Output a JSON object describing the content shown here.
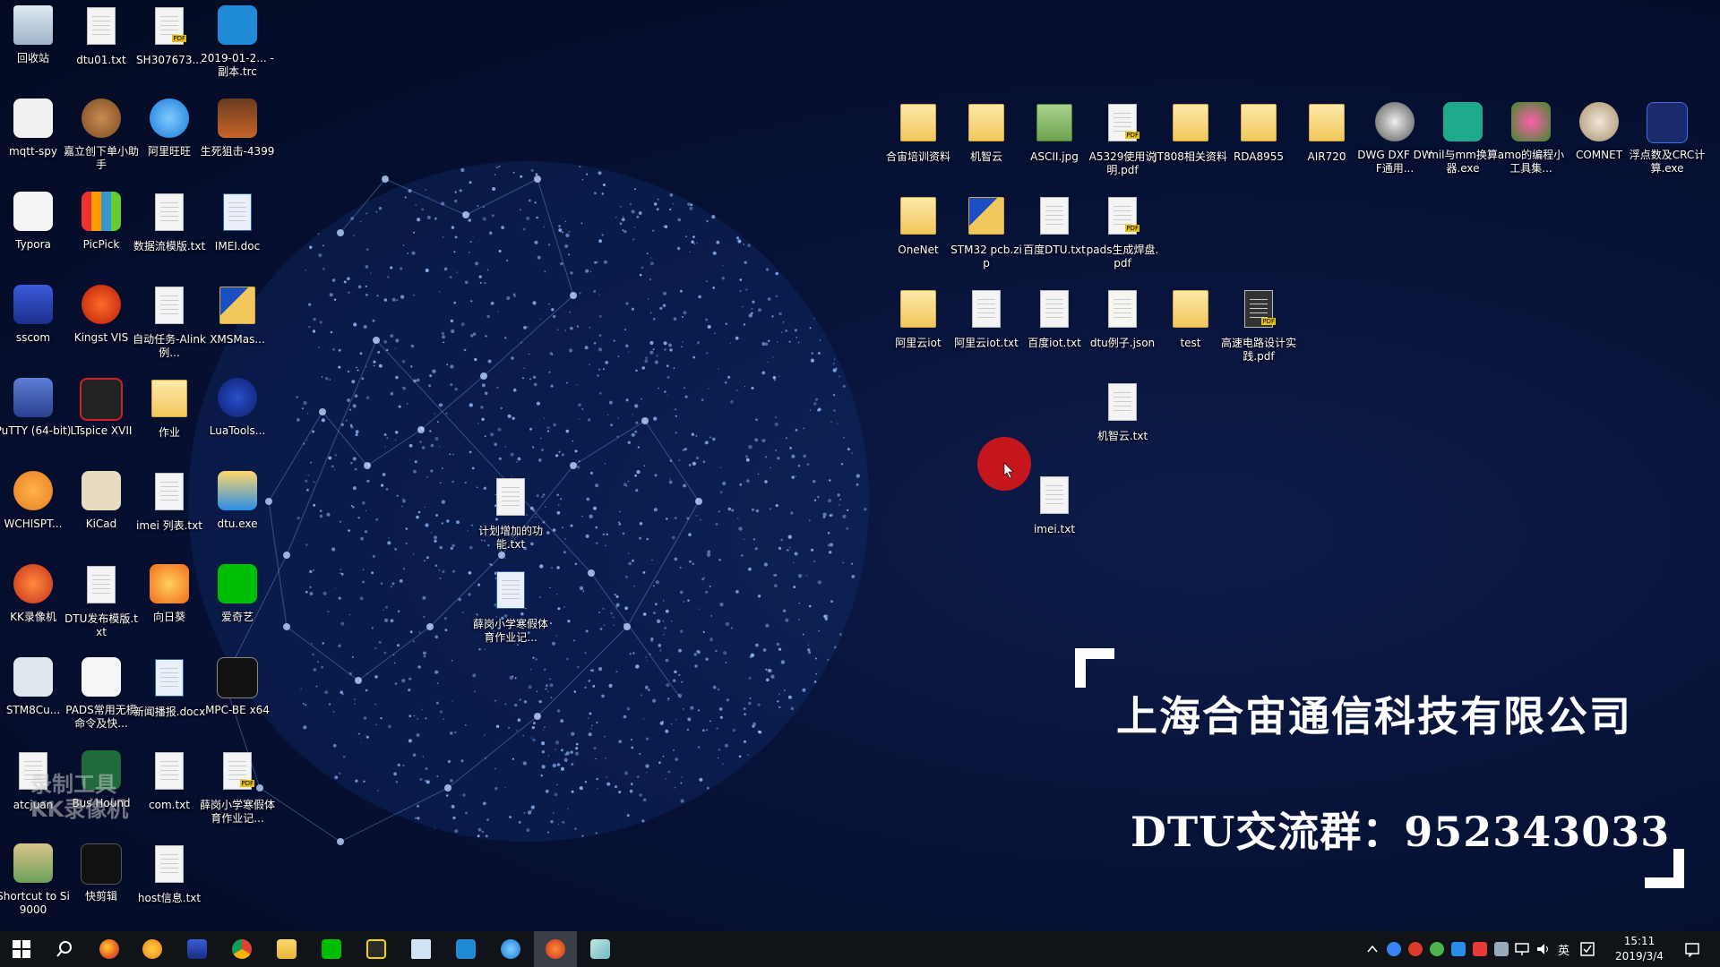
{
  "desktop": {
    "icons_left": [
      {
        "label": "回收站",
        "kind": "recycle"
      },
      {
        "label": "dtu01.txt",
        "kind": "file"
      },
      {
        "label": "SH307673...",
        "kind": "pdf"
      },
      {
        "label": "2019-01-2... - 副本.trc",
        "kind": "vscode"
      },
      {
        "label": "mqtt-spy",
        "kind": "java"
      },
      {
        "label": "嘉立创下单小助手",
        "kind": "bear"
      },
      {
        "label": "阿里旺旺",
        "kind": "wangwang"
      },
      {
        "label": "生死狙击-4399",
        "kind": "game"
      },
      {
        "label": "Typora",
        "kind": "typora"
      },
      {
        "label": "PicPick",
        "kind": "picpick"
      },
      {
        "label": "数据流模版.txt",
        "kind": "file"
      },
      {
        "label": "IMEI.doc",
        "kind": "doc"
      },
      {
        "label": "sscom",
        "kind": "sscom"
      },
      {
        "label": "Kingst VIS",
        "kind": "kingst"
      },
      {
        "label": "自动任务-Alink例...",
        "kind": "file"
      },
      {
        "label": "XMSMas...",
        "kind": "zipfolder"
      },
      {
        "label": "PuTTY (64-bit)",
        "kind": "putty"
      },
      {
        "label": "LTspice XVII",
        "kind": "ltspice"
      },
      {
        "label": "作业",
        "kind": "folder"
      },
      {
        "label": "LuaTools...",
        "kind": "luat"
      },
      {
        "label": "WCHISPT...",
        "kind": "wch"
      },
      {
        "label": "KiCad",
        "kind": "kicad"
      },
      {
        "label": "imei 列表.txt",
        "kind": "file"
      },
      {
        "label": "dtu.exe",
        "kind": "dtuexe"
      },
      {
        "label": "KK录像机",
        "kind": "kk"
      },
      {
        "label": "DTU发布模版.txt",
        "kind": "file"
      },
      {
        "label": "向日葵",
        "kind": "sunflower"
      },
      {
        "label": "爱奇艺",
        "kind": "iqiyi"
      },
      {
        "label": "STM8Cu...",
        "kind": "stm8"
      },
      {
        "label": "PADS常用无模命令及快...",
        "kind": "pads"
      },
      {
        "label": "新闻播报.docx",
        "kind": "doc"
      },
      {
        "label": "MPC-BE x64",
        "kind": "mpc"
      },
      {
        "label": "atcjuan",
        "kind": "file"
      },
      {
        "label": "Bus Hound",
        "kind": "bushound"
      },
      {
        "label": "com.txt",
        "kind": "file"
      },
      {
        "label": "薛岗小学寒假体育作业记...",
        "kind": "pdf"
      },
      {
        "label": "Shortcut to Si9000",
        "kind": "si9000"
      },
      {
        "label": "快剪辑",
        "kind": "kuaijianji"
      },
      {
        "label": "host信息.txt",
        "kind": "file"
      }
    ],
    "icons_middle": [
      {
        "label": "计划增加的功能.txt",
        "kind": "file"
      },
      {
        "label": "薛岗小学寒假体育作业记...",
        "kind": "doc"
      }
    ],
    "icons_right": [
      {
        "label": "合宙培训资料",
        "kind": "folder"
      },
      {
        "label": "机智云",
        "kind": "folder"
      },
      {
        "label": "ASCII.jpg",
        "kind": "jpg"
      },
      {
        "label": "A5329使用说明.pdf",
        "kind": "pdf"
      },
      {
        "label": "JT808相关资料",
        "kind": "folder"
      },
      {
        "label": "RDA8955",
        "kind": "folder"
      },
      {
        "label": "AIR720",
        "kind": "folder"
      },
      {
        "label": "DWG DXF DWF通用...",
        "kind": "dwg"
      },
      {
        "label": "mil与mm换算器.exe",
        "kind": "mil"
      },
      {
        "label": "amo的编程小工具集...",
        "kind": "amo"
      },
      {
        "label": "COMNET",
        "kind": "comnet"
      },
      {
        "label": "浮点数及CRC计算.exe",
        "kind": "crc"
      },
      {
        "label": "OneNet",
        "kind": "folder"
      },
      {
        "label": "STM32 pcb.zip",
        "kind": "zipfolder"
      },
      {
        "label": "百度DTU.txt",
        "kind": "file"
      },
      {
        "label": "pads生成焊盘.pdf",
        "kind": "pdf"
      },
      {
        "label": "阿里云iot",
        "kind": "folder"
      },
      {
        "label": "阿里云iot.txt",
        "kind": "file"
      },
      {
        "label": "百度iot.txt",
        "kind": "file"
      },
      {
        "label": "dtu例子.json",
        "kind": "json"
      },
      {
        "label": "test",
        "kind": "folder"
      },
      {
        "label": "高速电路设计实践.pdf",
        "kind": "bookpdf"
      },
      {
        "label": "机智云.txt",
        "kind": "file"
      },
      {
        "label": "imei.txt",
        "kind": "file"
      }
    ]
  },
  "banner": {
    "company": "上海合宙通信科技有限公司",
    "dtu_group": "DTU交流群：952343033"
  },
  "watermark": {
    "line1": "录制工具",
    "line2": "KK录像机"
  },
  "taskbar": {
    "apps": [
      "start-icon",
      "search-icon",
      "firefox-icon",
      "browser-icon",
      "app-icon",
      "chrome-icon",
      "explorer-icon",
      "iqiyi-icon",
      "notes-icon",
      "notepad-icon",
      "vscode-icon",
      "wangwang-icon",
      "kk-recorder-icon",
      "feather-icon"
    ],
    "ime": "英",
    "time": "15:11",
    "date": "2019/3/4"
  },
  "colors": {
    "taskbar": "#101418",
    "cursor_highlight": "#c4161c",
    "folder": "#f2c75c"
  }
}
